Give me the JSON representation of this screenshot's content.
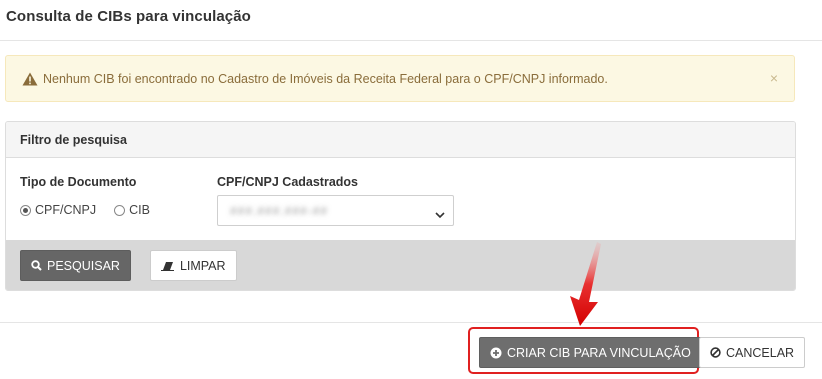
{
  "page": {
    "title": "Consulta de CIBs para vinculação"
  },
  "alert": {
    "message": "Nenhum CIB foi encontrado no Cadastro de Imóveis da Receita Federal para o CPF/CNPJ informado.",
    "close_symbol": "×",
    "icon": "warning-triangle-icon",
    "color": "#8a6d3b",
    "background": "#fcf8e3"
  },
  "filter": {
    "heading": "Filtro de pesquisa",
    "document_type": {
      "label": "Tipo de Documento",
      "options": [
        "CPF/CNPJ",
        "CIB"
      ],
      "selected": "CPF/CNPJ"
    },
    "registered": {
      "label": "CPF/CNPJ Cadastrados",
      "selected_value": "###.###.###-##"
    },
    "buttons": {
      "search": "PESQUISAR",
      "clear": "LIMPAR"
    }
  },
  "actions": {
    "create": "CRIAR CIB PARA VINCULAÇÃO",
    "cancel": "CANCELAR"
  },
  "annotation": {
    "highlight_color": "#e02020"
  }
}
